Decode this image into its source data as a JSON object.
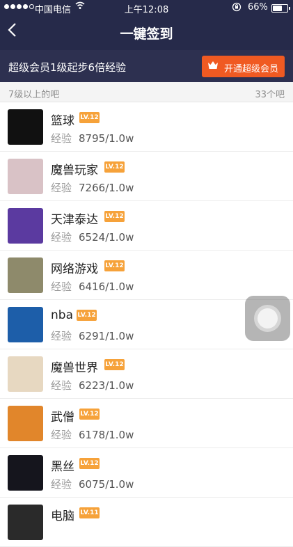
{
  "status": {
    "carrier": "中国电信",
    "time": "上午12:08",
    "battery": "66%",
    "battery_fraction": 0.66
  },
  "header": {
    "title": "一键签到"
  },
  "promo": {
    "text": "超级会员1级起步6倍经验",
    "button_label": "开通超级会员"
  },
  "section": {
    "title": "7级以上的吧",
    "count": "33个吧"
  },
  "exp_label": "经验",
  "forums": [
    {
      "name": "篮球",
      "level": "LV.12",
      "exp": "8795/1.0w",
      "thumb_color": "#111111"
    },
    {
      "name": "魔兽玩家",
      "level": "LV.12",
      "exp": "7266/1.0w",
      "thumb_color": "#d9c2c6"
    },
    {
      "name": "天津泰达",
      "level": "LV.12",
      "exp": "6524/1.0w",
      "thumb_color": "#5b3aa0"
    },
    {
      "name": "网络游戏",
      "level": "LV.12",
      "exp": "6416/1.0w",
      "thumb_color": "#8e8a6b"
    },
    {
      "name": "nba",
      "level": "LV.12",
      "exp": "6291/1.0w",
      "thumb_color": "#1d5ea9"
    },
    {
      "name": "魔兽世界",
      "level": "LV.12",
      "exp": "6223/1.0w",
      "thumb_color": "#e7d8c1"
    },
    {
      "name": "武僧",
      "level": "LV.12",
      "exp": "6178/1.0w",
      "thumb_color": "#e1862b"
    },
    {
      "name": "黑丝",
      "level": "LV.12",
      "exp": "6075/1.0w",
      "thumb_color": "#15151d"
    },
    {
      "name": "电脑",
      "level": "LV.11",
      "exp": "",
      "thumb_color": "#2a2a2a"
    }
  ]
}
